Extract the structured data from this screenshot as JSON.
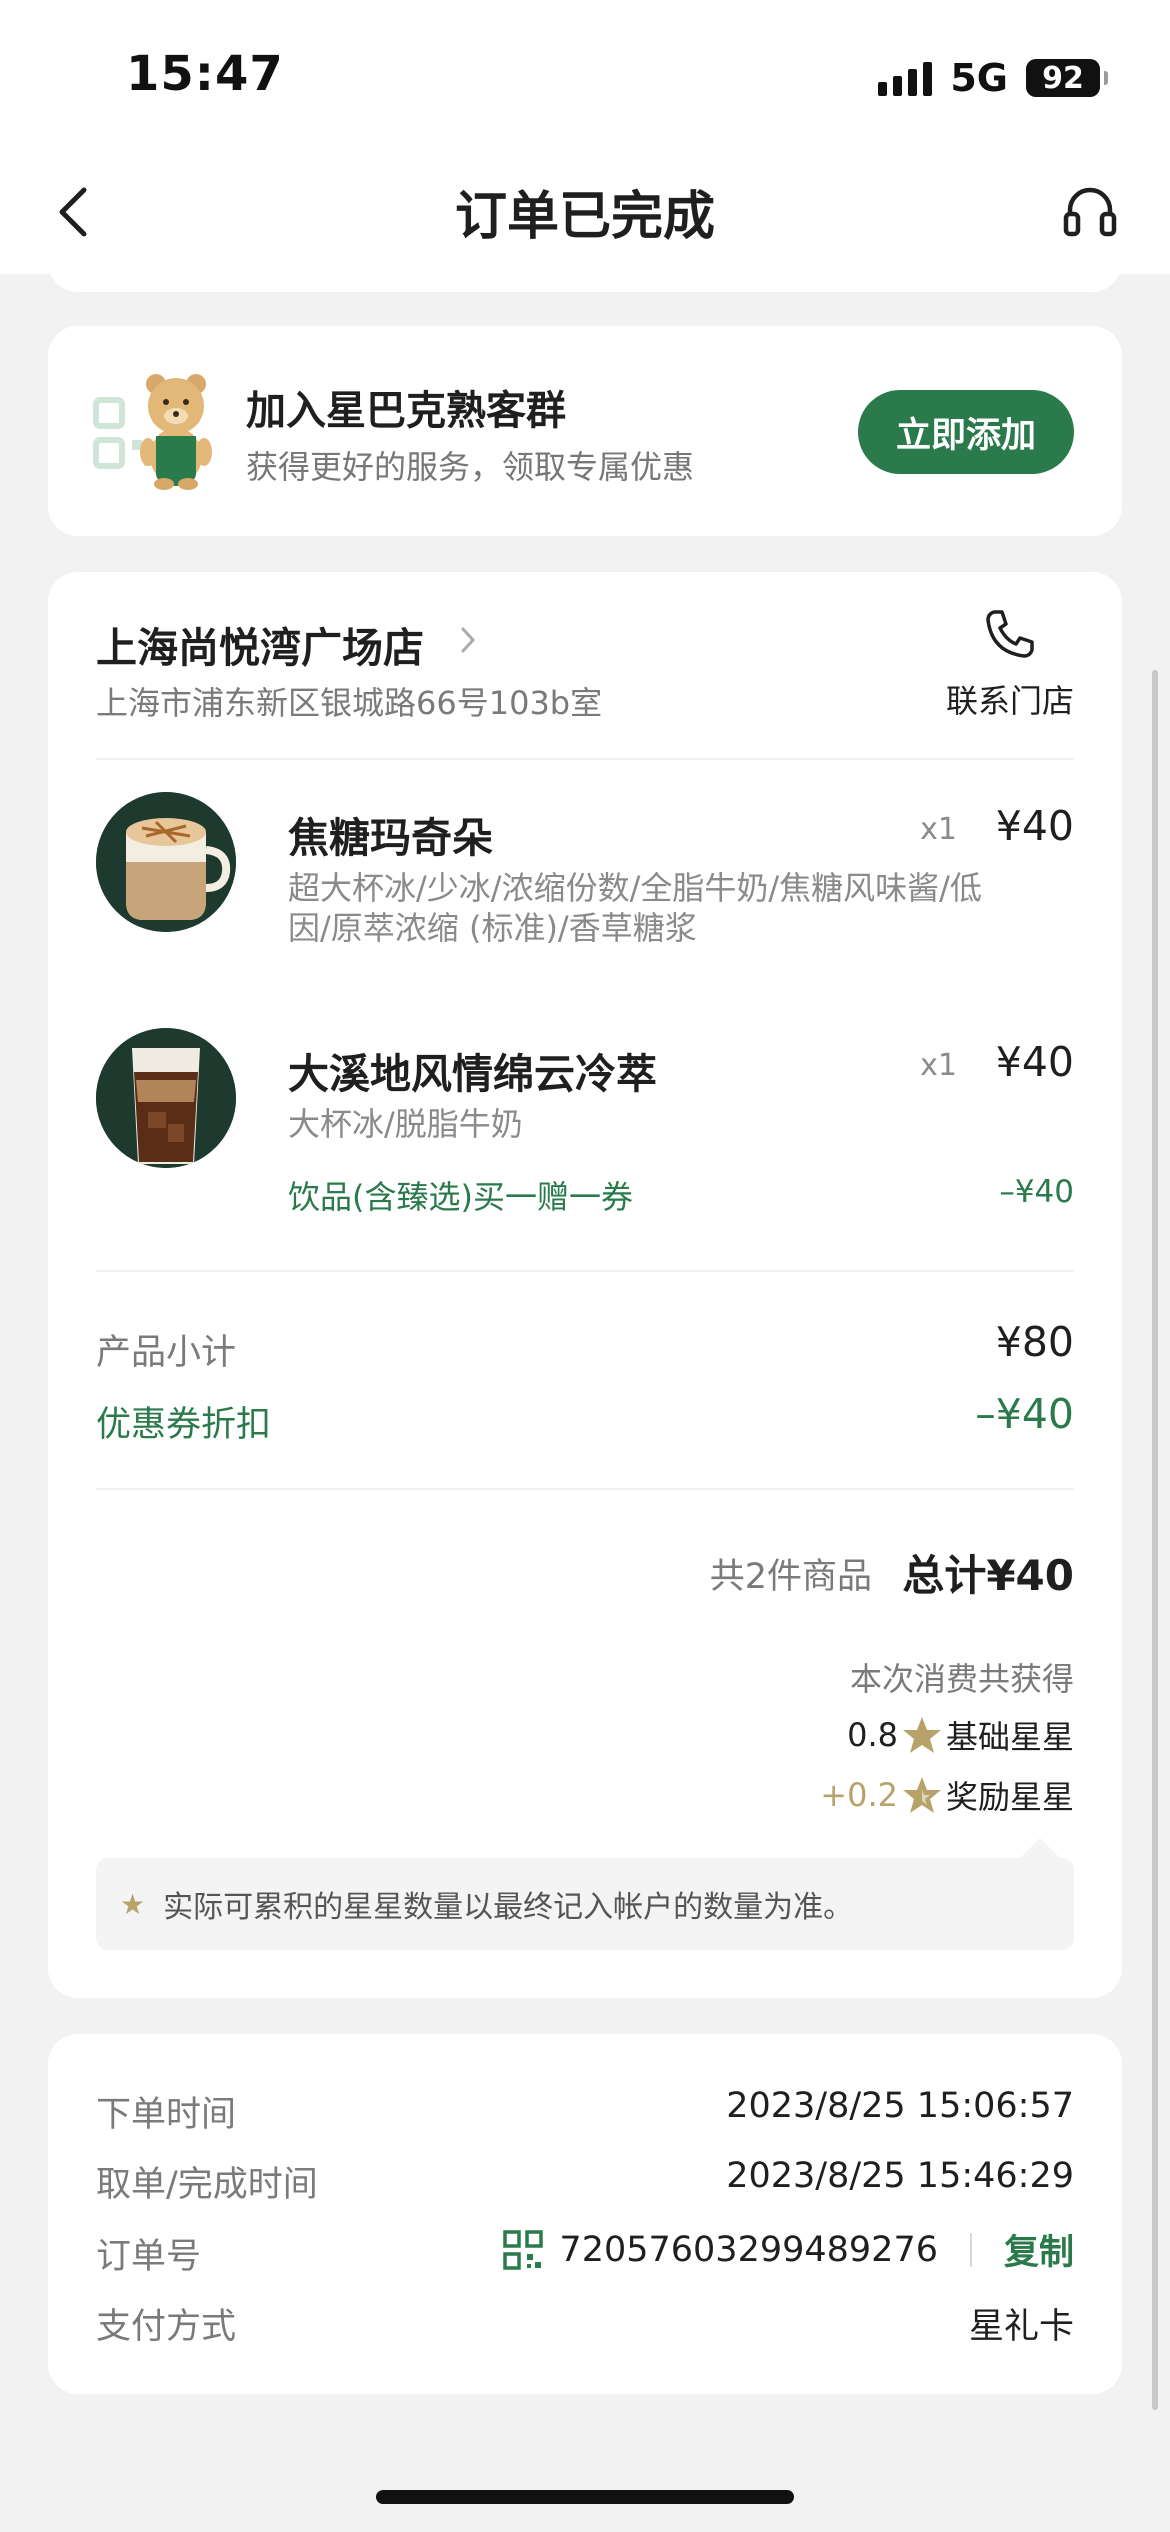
{
  "status_bar": {
    "time": "15:47",
    "network": "5G",
    "battery": "92"
  },
  "nav": {
    "title": "订单已完成"
  },
  "join_group": {
    "title": "加入星巴克熟客群",
    "subtitle": "获得更好的服务，领取专属优惠",
    "button_label": "立即添加"
  },
  "store": {
    "name": "上海尚悦湾广场店",
    "address": "上海市浦东新区银城路66号103b室",
    "contact_label": "联系门店"
  },
  "items": [
    {
      "name": "焦糖玛奇朵",
      "qty": "x1",
      "price": "¥40",
      "spec_line1": "超大杯冰/少冰/浓缩份数/全脂牛奶/焦糖风味酱/低",
      "spec_line2": "因/原萃浓缩 (标准)/香草糖浆"
    },
    {
      "name": "大溪地风情绵云冷萃",
      "qty": "x1",
      "price": "¥40",
      "spec_line1": "大杯冰/脱脂牛奶",
      "coupon": "饮品(含臻选)买一赠一券",
      "discount": "–¥40"
    }
  ],
  "summary": {
    "subtotal_label": "产品小计",
    "subtotal_value": "¥80",
    "coupon_label": "优惠券折扣",
    "coupon_value": "–¥40",
    "count_text": "共2件商品",
    "total_text": "总计¥40"
  },
  "stars": {
    "title": "本次消费共获得",
    "base_value": "0.8",
    "base_label": "基础星星",
    "bonus_value": "+0.2",
    "bonus_label": "奖励星星",
    "note": "实际可累积的星星数量以最终记入帐户的数量为准。"
  },
  "order_info": {
    "order_time_label": "下单时间",
    "order_time_value": "2023/8/25 15:06:57",
    "finish_time_label": "取单/完成时间",
    "finish_time_value": "2023/8/25 15:46:29",
    "order_no_label": "订单号",
    "order_no_value": "72057603299489276",
    "copy_label": "复制",
    "payment_label": "支付方式",
    "payment_value": "星礼卡"
  },
  "colors": {
    "brand_green": "#2b7a4b",
    "star_gold": "#b7a36a",
    "page_background": "#f2f2f3"
  },
  "icons": [
    "back-icon",
    "headset-icon",
    "qr-icon",
    "bear-mascot",
    "phone-icon",
    "star-icon",
    "qr-code-icon"
  ]
}
